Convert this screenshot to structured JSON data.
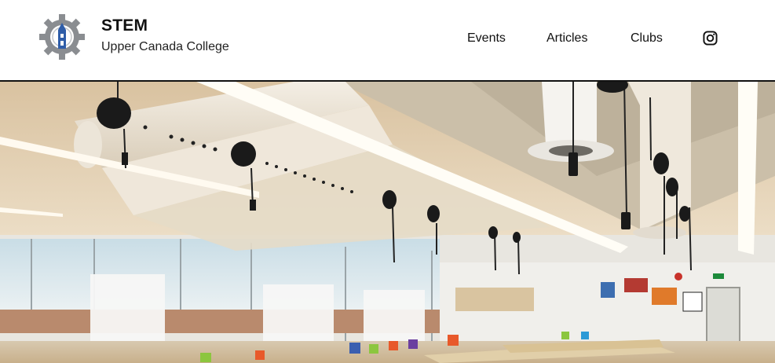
{
  "brand": {
    "title": "STEM",
    "subtitle": "Upper Canada College",
    "logo_icon": "gear-tower-logo-icon"
  },
  "nav": {
    "items": [
      {
        "label": "Events"
      },
      {
        "label": "Articles"
      },
      {
        "label": "Clubs"
      }
    ],
    "instagram_icon": "instagram-icon"
  },
  "hero": {
    "image": "classroom-lab-photo"
  },
  "colors": {
    "logo_gray": "#8a8d91",
    "logo_blue": "#2f5da8",
    "header_border": "#111111"
  }
}
